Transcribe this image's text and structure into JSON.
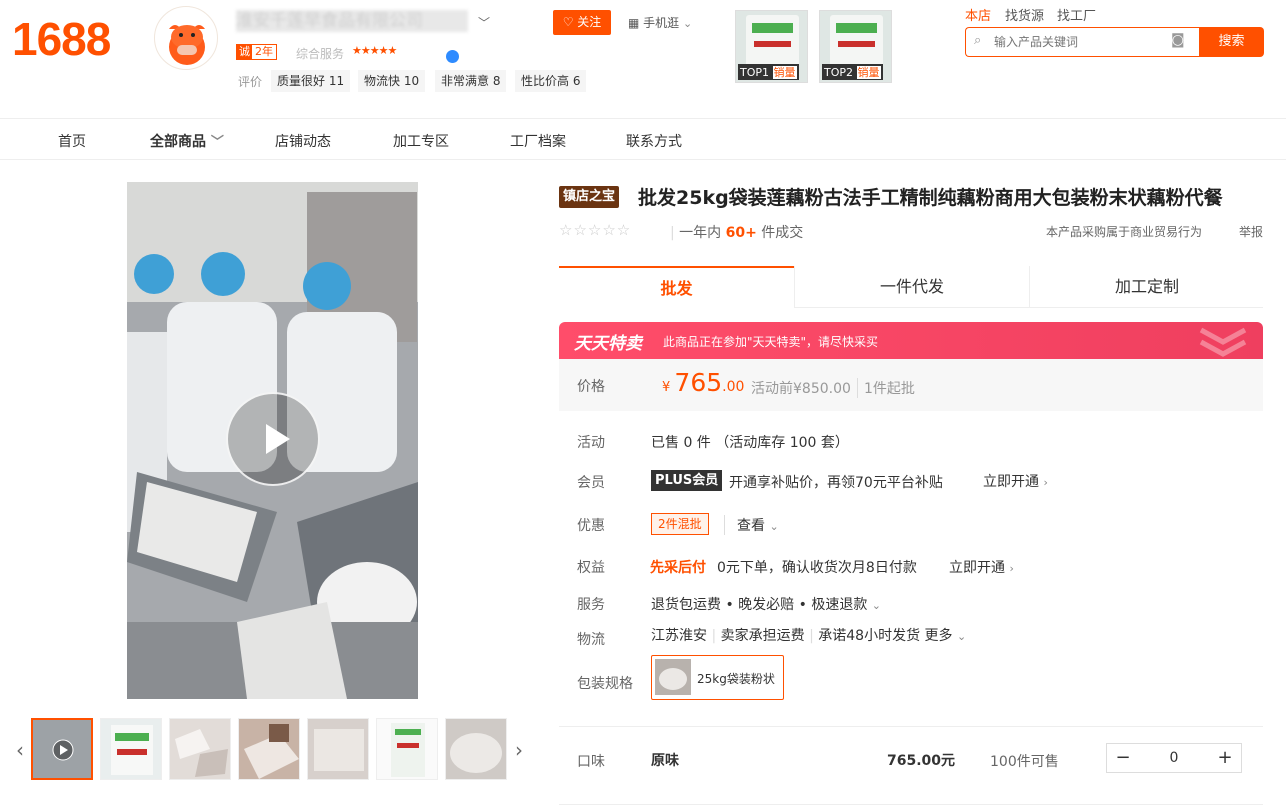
{
  "brand": {
    "logo_text": "1688"
  },
  "shop": {
    "name": "淮安千莲早食品有限公司",
    "years_badge_a": "诚",
    "years_badge_b": "2年",
    "service_label": "综合服务",
    "stars": "★★★★★",
    "eval_label": "评价",
    "tags": [
      "质量很好 11",
      "物流快 10",
      "非常满意 8",
      "性比价高 6"
    ],
    "follow_label": "关注",
    "mobile_label": "手机逛"
  },
  "top_products": [
    {
      "rank": "TOP1",
      "label": "销量"
    },
    {
      "rank": "TOP2",
      "label": "销量"
    }
  ],
  "search": {
    "tabs": [
      "本店",
      "找货源",
      "找工厂"
    ],
    "placeholder": "输入产品关键词",
    "button": "搜索"
  },
  "nav": [
    "首页",
    "全部商品",
    "店铺动态",
    "加工专区",
    "工厂档案",
    "联系方式"
  ],
  "product": {
    "treasure_badge": "镇店之宝",
    "title": "批发25kg袋装莲藕粉古法手工精制纯藕粉商用大包装粉末状藕粉代餐",
    "rating_stars": "☆☆☆☆☆",
    "sold_prefix": "一年内",
    "sold_count": "60+",
    "sold_suffix": "件成交",
    "biz_note": "本产品采购属于商业贸易行为",
    "report": "举报",
    "tabs": [
      "批发",
      "一件代发",
      "加工定制"
    ],
    "promo": {
      "name": "天天特卖",
      "text": "此商品正在参加\"天天特卖\"，请尽快采买"
    },
    "price": {
      "label": "价格",
      "currency": "¥",
      "integer": "765",
      "decimal": ".00",
      "before": "活动前¥850.00",
      "min_order": "1件起批"
    },
    "activity": {
      "label": "活动",
      "value": "已售 0 件 （活动库存 100 套）"
    },
    "member": {
      "label": "会员",
      "badge": "PLUS会员",
      "text": "开通享补贴价，再领70元平台补贴",
      "link": "立即开通"
    },
    "discount": {
      "label": "优惠",
      "badge": "2件混批",
      "link": "查看"
    },
    "rights": {
      "label": "权益",
      "badge": "先采后付",
      "text": "0元下单，确认收货次月8日付款",
      "link": "立即开通"
    },
    "service": {
      "label": "服务",
      "value": "退货包运费 • 晚发必赔 • 极速退款"
    },
    "logistics": {
      "label": "物流",
      "origin": "江苏淮安",
      "freight": "卖家承担运费",
      "promise": "承诺48小时发货",
      "more": "更多"
    },
    "package": {
      "label": "包装规格",
      "option": "25kg袋装粉状"
    },
    "sku": {
      "label": "口味",
      "flavor": "原味",
      "price": "765.00元",
      "stock": "100件可售",
      "qty": "0"
    }
  },
  "colors": {
    "accent": "#ff5000",
    "promo": "#ef3f5f"
  }
}
